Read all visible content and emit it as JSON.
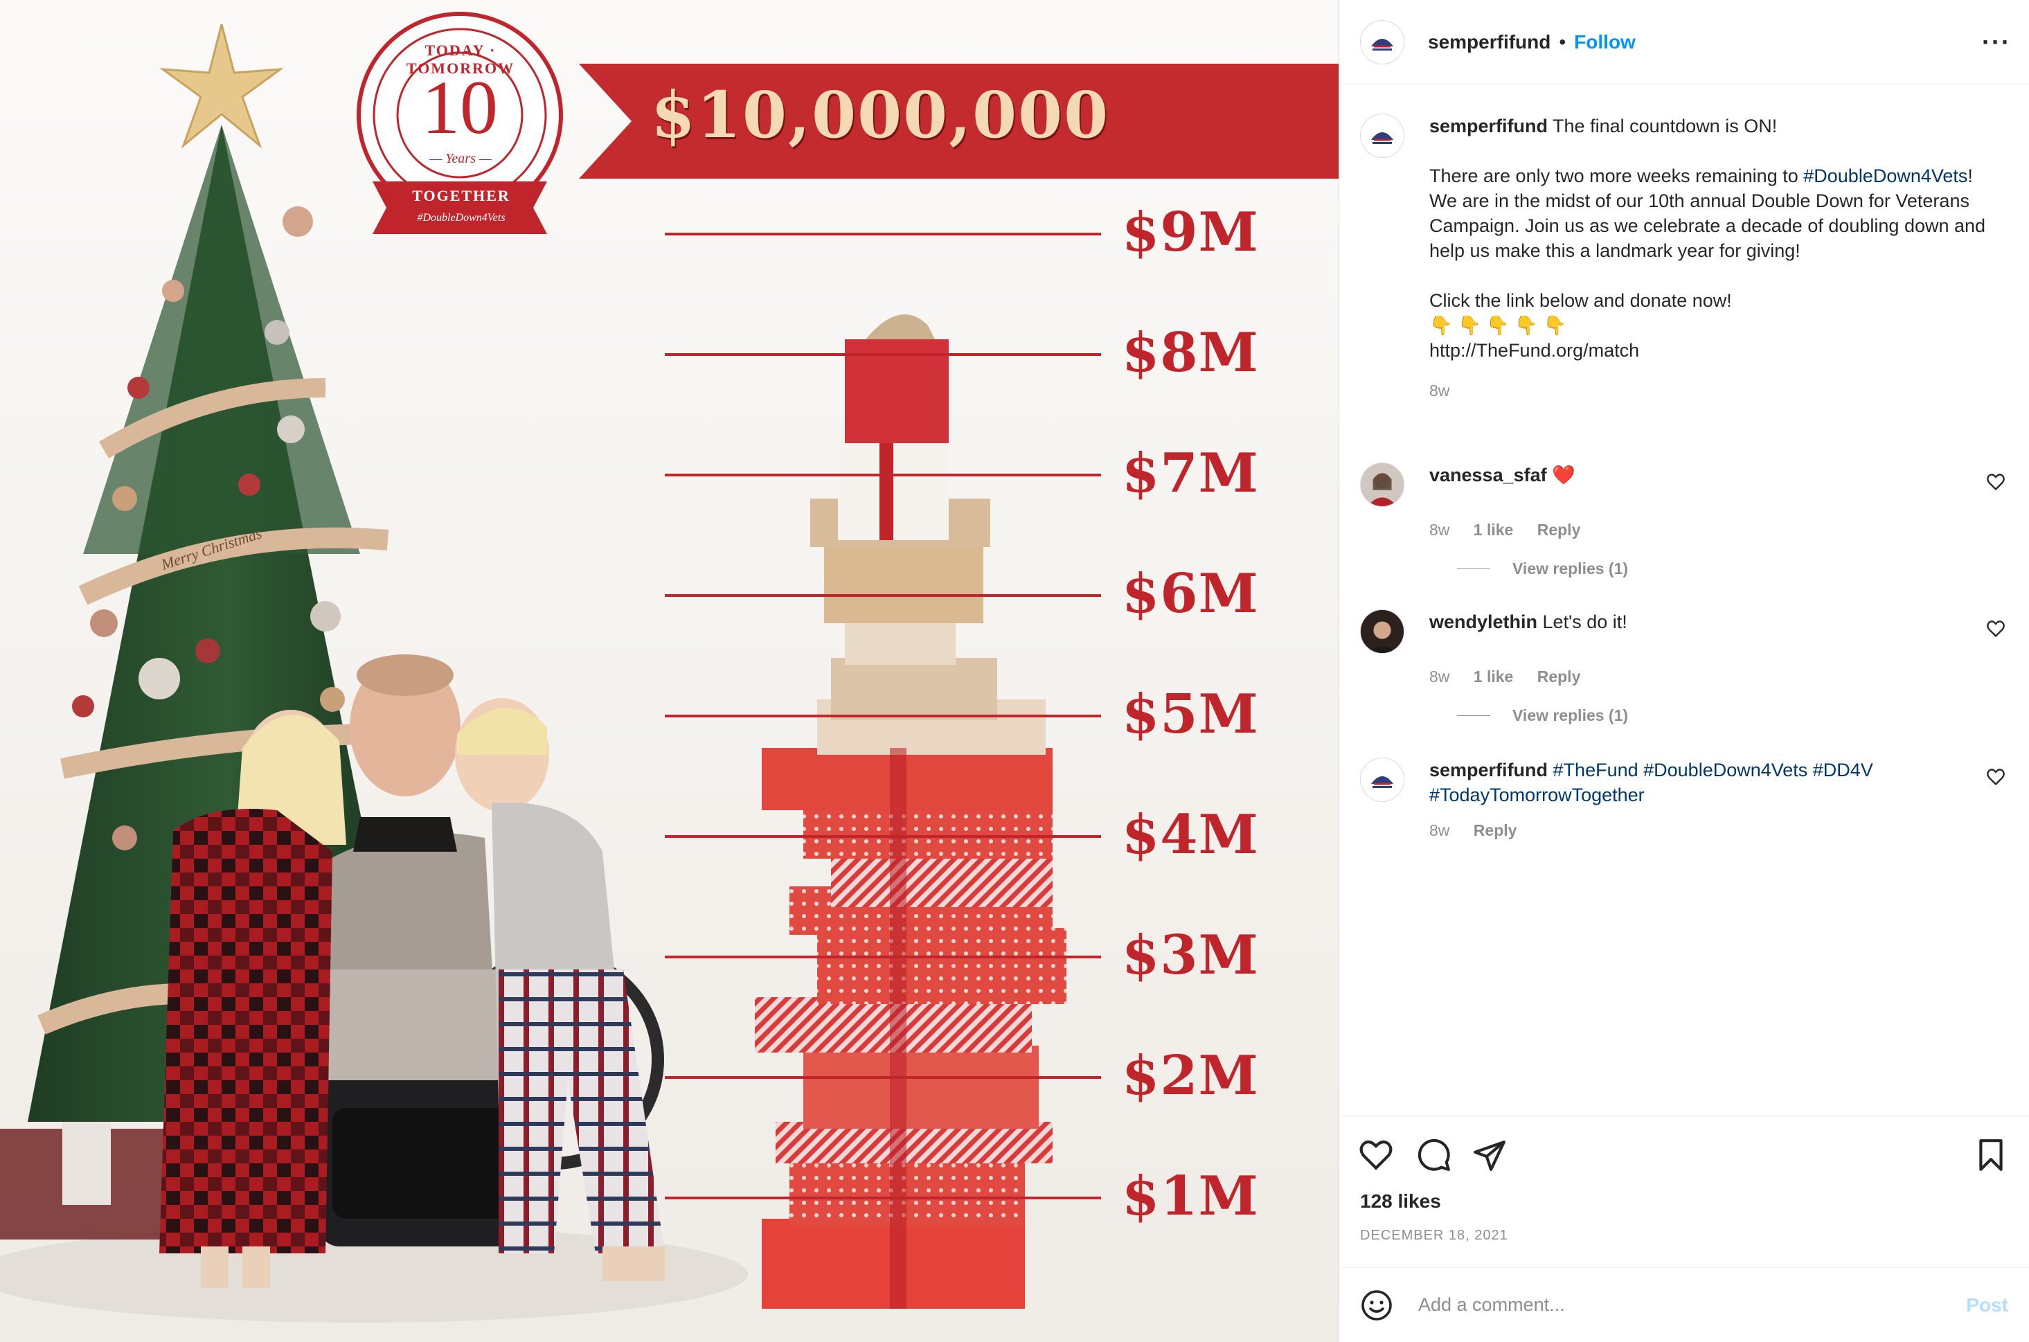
{
  "image": {
    "badge_top": "TODAY · TOMORROW",
    "badge_number": "10",
    "badge_years": "— Years —",
    "badge_bottom": "TOGETHER",
    "badge_hashtag": "#DoubleDown4Vets",
    "banner_amount": "$10,000,000",
    "milestones": [
      "$9M",
      "$8M",
      "$7M",
      "$6M",
      "$5M",
      "$4M",
      "$3M",
      "$2M",
      "$1M"
    ],
    "ribbon_text": "Merry Christmas",
    "colors": {
      "brand_red": "#c0252b",
      "banner_red": "#c32b2f",
      "gold": "#f3d9b4"
    }
  },
  "header": {
    "username": "semperfifund",
    "separator": "•",
    "follow_label": "Follow",
    "more_label": "···"
  },
  "caption": {
    "username": "semperfifund",
    "line1": "The final countdown is ON!",
    "para2_start": "There are only two more weeks remaining to ",
    "para2_tag": "#DoubleDown4Vets",
    "para2_end": "! We are in the midst of our 10th annual Double Down for Veterans Campaign. Join us as we celebrate a decade of doubling down and help us make this a landmark year for giving!",
    "para3": "Click the link below and donate now!",
    "emoji_row": "👇 👇 👇 👇 👇",
    "url": "http://TheFund.org/match",
    "time": "8w"
  },
  "comments": [
    {
      "username": "vanessa_sfaf",
      "text": "❤️",
      "time": "8w",
      "likes": "1 like",
      "reply_label": "Reply",
      "view_replies": "View replies (1)"
    },
    {
      "username": "wendylethin",
      "text": "Let's do it!",
      "time": "8w",
      "likes": "1 like",
      "reply_label": "Reply",
      "view_replies": "View replies (1)"
    },
    {
      "username": "semperfifund",
      "tags": "#TheFund #DoubleDown4Vets #DD4V #TodayTomorrowTogether",
      "time": "8w",
      "reply_label": "Reply"
    }
  ],
  "actions": {
    "icons": [
      "heart-icon",
      "comment-icon",
      "share-icon",
      "bookmark-icon"
    ],
    "likes": "128 likes",
    "date": "DECEMBER 18, 2021"
  },
  "comment_box": {
    "placeholder": "Add a comment...",
    "post_label": "Post",
    "emoji_icon": "smiley-icon"
  }
}
